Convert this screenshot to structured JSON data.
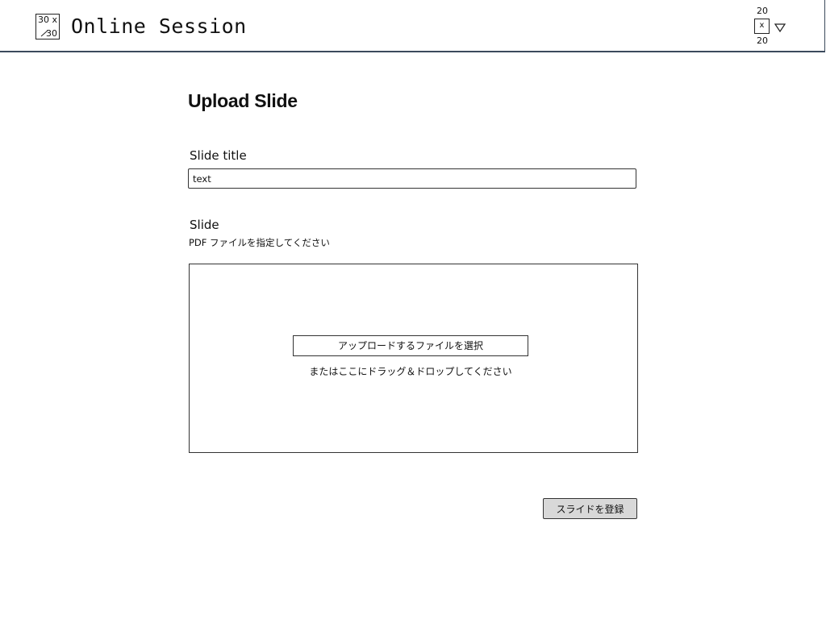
{
  "header": {
    "logo_placeholder": {
      "top": "30 x",
      "bottom": "30"
    },
    "app_title": "Online Session",
    "avatar": {
      "width_label": "20",
      "height_label": "20",
      "glyph": "x"
    },
    "menu_icon": "triangle-down-icon"
  },
  "main": {
    "page_title": "Upload Slide",
    "slide_title_field": {
      "label": "Slide title",
      "value": "text"
    },
    "slide_field": {
      "label": "Slide",
      "hint": "PDF ファイルを指定してください"
    },
    "dropzone": {
      "select_button_label": "アップロードするファイルを選択",
      "drop_text": "またはここにドラッグ＆ドロップしてください"
    },
    "register_button_label": "スライドを登録"
  }
}
